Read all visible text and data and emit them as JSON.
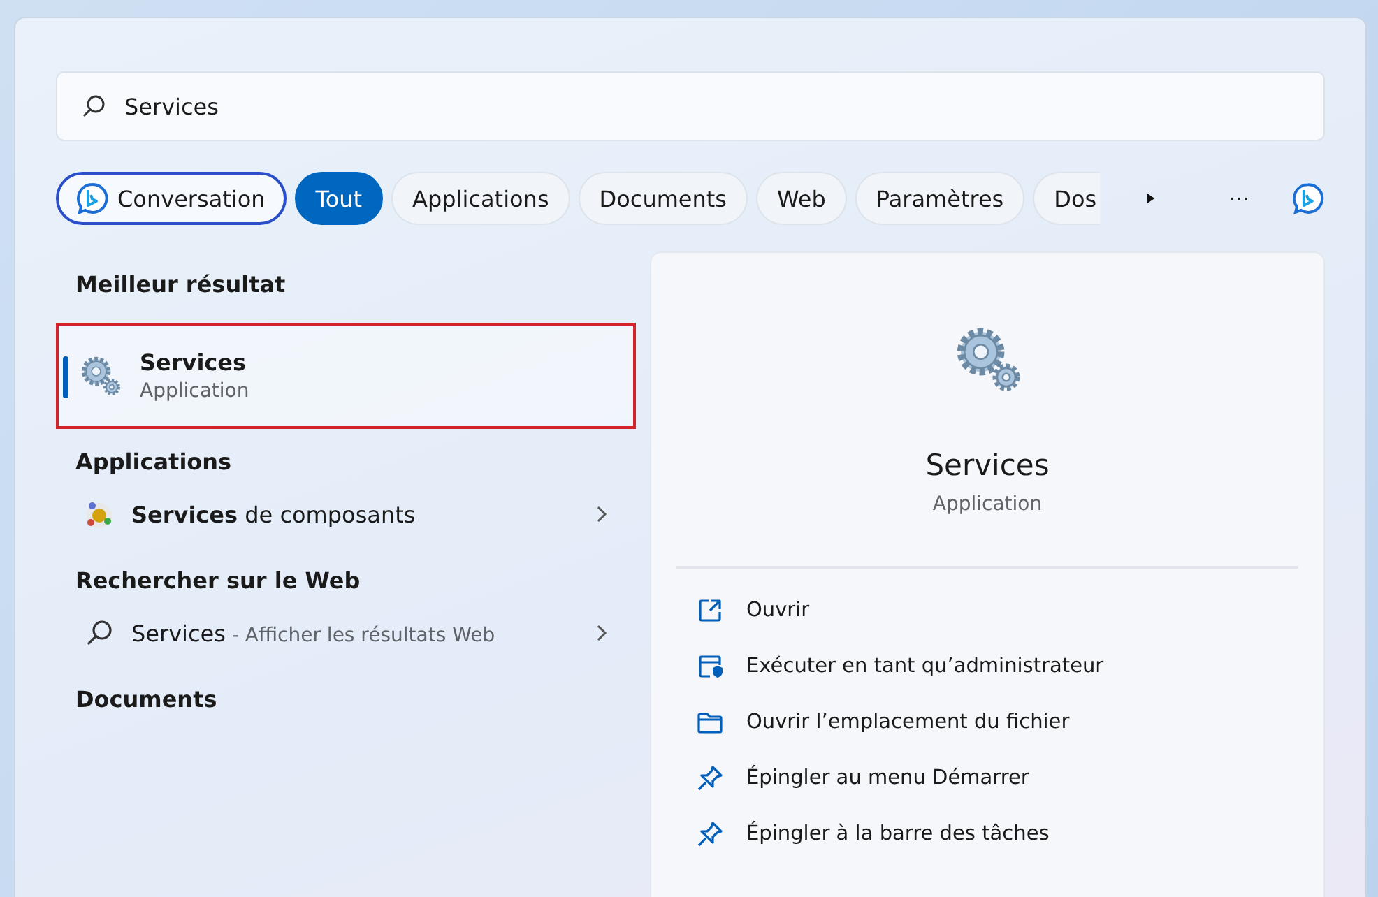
{
  "search": {
    "value": "Services"
  },
  "chips": [
    {
      "kind": "conversation",
      "label": "Conversation",
      "selected": false
    },
    {
      "kind": "filter",
      "label": "Tout",
      "selected": true
    },
    {
      "kind": "filter",
      "label": "Applications",
      "selected": false
    },
    {
      "kind": "filter",
      "label": "Documents",
      "selected": false
    },
    {
      "kind": "filter",
      "label": "Web",
      "selected": false
    },
    {
      "kind": "filter",
      "label": "Paramètres",
      "selected": false
    },
    {
      "kind": "filter",
      "label": "Dos",
      "selected": false
    }
  ],
  "more_label": "···",
  "best_match": {
    "heading": "Meilleur résultat",
    "title": "Services",
    "subtitle": "Application",
    "selected": true,
    "highlighted": true
  },
  "apps": {
    "heading": "Applications",
    "items": [
      {
        "label": "**Services** de composants"
      }
    ]
  },
  "web": {
    "heading": "Rechercher sur le Web",
    "items": [
      {
        "term": "Services",
        "hint": " - Afficher les résultats Web"
      }
    ]
  },
  "documents": {
    "heading": "Documents"
  },
  "preview": {
    "title": "Services",
    "subtitle": "Application",
    "actions": [
      {
        "kind": "open",
        "label": "Ouvrir"
      },
      {
        "kind": "admin",
        "label": "Exécuter en tant qu’administrateur"
      },
      {
        "kind": "folder",
        "label": "Ouvrir l’emplacement du fichier"
      },
      {
        "kind": "pin",
        "label": "Épingler au menu Démarrer"
      },
      {
        "kind": "pin",
        "label": "Épingler à la barre des tâches"
      }
    ]
  }
}
